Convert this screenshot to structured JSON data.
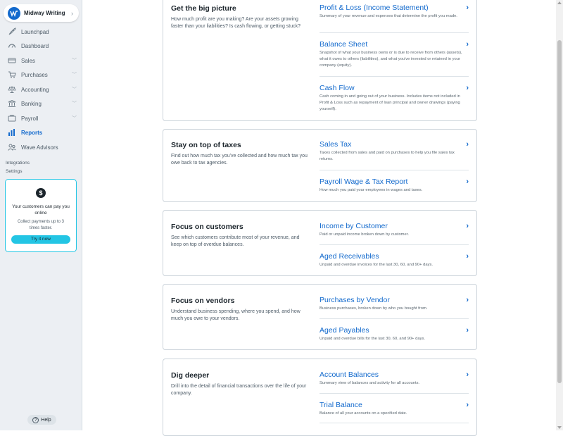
{
  "sidebar": {
    "business_name": "Midway Writing",
    "items": [
      {
        "label": "Launchpad",
        "icon": "rocket-icon"
      },
      {
        "label": "Dashboard",
        "icon": "dashboard-icon"
      },
      {
        "label": "Sales",
        "icon": "sales-icon",
        "expandable": true
      },
      {
        "label": "Purchases",
        "icon": "cart-icon",
        "expandable": true
      },
      {
        "label": "Accounting",
        "icon": "scale-icon",
        "expandable": true
      },
      {
        "label": "Banking",
        "icon": "bank-icon",
        "expandable": true
      },
      {
        "label": "Payroll",
        "icon": "payroll-icon",
        "expandable": true
      },
      {
        "label": "Reports",
        "icon": "bar-chart-icon",
        "active": true
      },
      {
        "label": "Wave Advisors",
        "icon": "advisors-icon"
      }
    ],
    "integrations_label": "Integrations",
    "settings_label": "Settings",
    "promo": {
      "title": "Your customers can pay you online",
      "subtitle": "Collect payments up to 3 times faster.",
      "button": "Try it now"
    },
    "help_label": "Help"
  },
  "sections": [
    {
      "title": "Get the big picture",
      "description": "How much profit are you making? Are your assets growing faster than your liabilities? Is cash flowing, or getting stuck?",
      "reports": [
        {
          "title": "Profit & Loss (Income Statement)",
          "description": "Summary of your revenue and expenses that determine the profit you made."
        },
        {
          "title": "Balance Sheet",
          "description": "Snapshot of what your business owns or is due to receive from others (assets), what it owes to others (liabilities), and what you've invested or retained in your company (equity)."
        },
        {
          "title": "Cash Flow",
          "description": "Cash coming in and going out of your business. Includes items not included in Profit & Loss such as repayment of loan principal and owner drawings (paying yourself)."
        }
      ]
    },
    {
      "title": "Stay on top of taxes",
      "description": "Find out how much tax you've collected and how much tax you owe back to tax agencies.",
      "reports": [
        {
          "title": "Sales Tax",
          "description": "Taxes collected from sales and paid on purchases to help you file sales tax returns."
        },
        {
          "title": "Payroll Wage & Tax Report",
          "description": "How much you paid your employees in wages and taxes."
        }
      ]
    },
    {
      "title": "Focus on customers",
      "description": "See which customers contribute most of your revenue, and keep on top of overdue balances.",
      "reports": [
        {
          "title": "Income by Customer",
          "description": "Paid or unpaid income broken down by customer."
        },
        {
          "title": "Aged Receivables",
          "description": "Unpaid and overdue invoices for the last 30, 60, and 90+ days."
        }
      ]
    },
    {
      "title": "Focus on vendors",
      "description": "Understand business spending, where you spend, and how much you owe to your vendors.",
      "reports": [
        {
          "title": "Purchases by Vendor",
          "description": "Business purchases, broken down by who you bought from."
        },
        {
          "title": "Aged Payables",
          "description": "Unpaid and overdue bills for the last 30, 60, and 90+ days."
        }
      ]
    },
    {
      "title": "Dig deeper",
      "description": "Drill into the detail of financial transactions over the life of your company.",
      "reports": [
        {
          "title": "Account Balances",
          "description": "Summary view of balances and activity for all accounts."
        },
        {
          "title": "Trial Balance",
          "description": "Balance of all your accounts on a specified date."
        }
      ]
    }
  ],
  "colors": {
    "accent": "#136acd",
    "promo": "#23c5e4",
    "sidebar_bg": "#eceff3"
  }
}
